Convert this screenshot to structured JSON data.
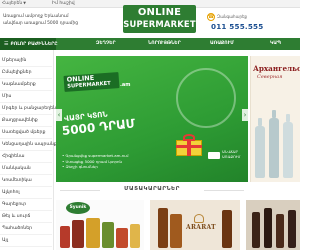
{
  "topbar": {
    "language": "Հայերեն",
    "account": "Իմ հաշիվ"
  },
  "header": {
    "tagline_line1": "Առաքում ամբողջ Երևանում",
    "tagline_line2": "անվճար առաքում 5000 դրամից",
    "logo_top": "ONLINE",
    "logo_bottom": "SUPERMARKET",
    "phone_label": "Զանգահարեք",
    "phone": "011 555.555"
  },
  "nav": {
    "all_categories": "ԲՈԼՈՐ ԲԱԺԻՆՆԵՐԸ",
    "items": [
      "ԶԵՂՉԵՐ",
      "ՆՈՐՈՒՅԹՆԵՐ",
      "ԱՌԱՔՈՒՄ",
      "ԿԱՊ"
    ]
  },
  "categories": [
    "Մթերային",
    "Ըմպելիքներ",
    "Կաթնամթերք",
    "Միս",
    "Մրգեր և բանջարեղեն",
    "Քաղցրավենիք",
    "Սառեցված մթերք",
    "Կենցաղային ապրանքներ",
    "Հիգիենա",
    "Մանկական",
    "Կոսմետիկա",
    "Ալկոհոլ",
    "Գարեջուր",
    "Թեյ և սուրճ",
    "Պահածոներ",
    "Այլ"
  ],
  "banner": {
    "logo_top": "ONLINE",
    "logo_bottom": "SUPERMARKET",
    "logo_domain": ".am",
    "promo_small": "ՎԱՅՐ ԿՏՈՆ",
    "promo_big": "5000 ԴՐԱՄ",
    "bullets": [
      "• Գրանցվեք supermarket.am-ում",
      "• Ստացեք 5000 դրամ կտրոն",
      "• Զեղչի գնումներ"
    ],
    "delivery_line1": "ԱՆՎՃԱՐ",
    "delivery_line2": "ԱՌԱՔՈՒՄ",
    "slides": 4,
    "active_slide": 1
  },
  "side_ad": {
    "title": "Архангельская",
    "subtitle": "Северная"
  },
  "products_section": {
    "title": "ՄԱՏԱԿԱՐԱՐՆԵՐ"
  },
  "tiles": {
    "syunik": "Syunik",
    "ararat": "ARARAT"
  },
  "colors": {
    "brand_green": "#2e7d32",
    "phone_blue": "#1c4f91",
    "accent_yellow": "#e6a100"
  }
}
